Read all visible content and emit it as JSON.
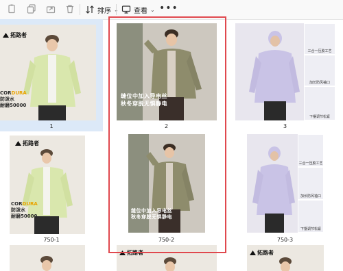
{
  "toolbar": {
    "sort_label": "排序",
    "view_label": "查看",
    "more_label": "•••"
  },
  "items": [
    {
      "id": "a",
      "caption": "1"
    },
    {
      "id": "b",
      "caption": "2"
    },
    {
      "id": "c",
      "caption": "3"
    },
    {
      "id": "d",
      "caption": "750-1"
    },
    {
      "id": "e",
      "caption": "750-2"
    },
    {
      "id": "f",
      "caption": "750-3"
    }
  ],
  "brand_text": "拓路者",
  "cordura": {
    "pre": "COR",
    "accent": "DURA"
  },
  "item1_promo": [
    "防泼水",
    "耐磨50000"
  ],
  "item2_overlay": [
    "缝位中加入导电丝",
    "秋冬穿脱无惧静电"
  ],
  "item3_labels": [
    "三合一压胶工艺",
    "加长防风袖口",
    "下摆调节松紧"
  ],
  "colors": {
    "accent_selection": "#dce9f8",
    "highlight_border": "#e0484e",
    "jacket_green": "#d9e7ad",
    "jacket_olive": "#8e8c6c",
    "jacket_lavender": "#c9c3e6"
  }
}
